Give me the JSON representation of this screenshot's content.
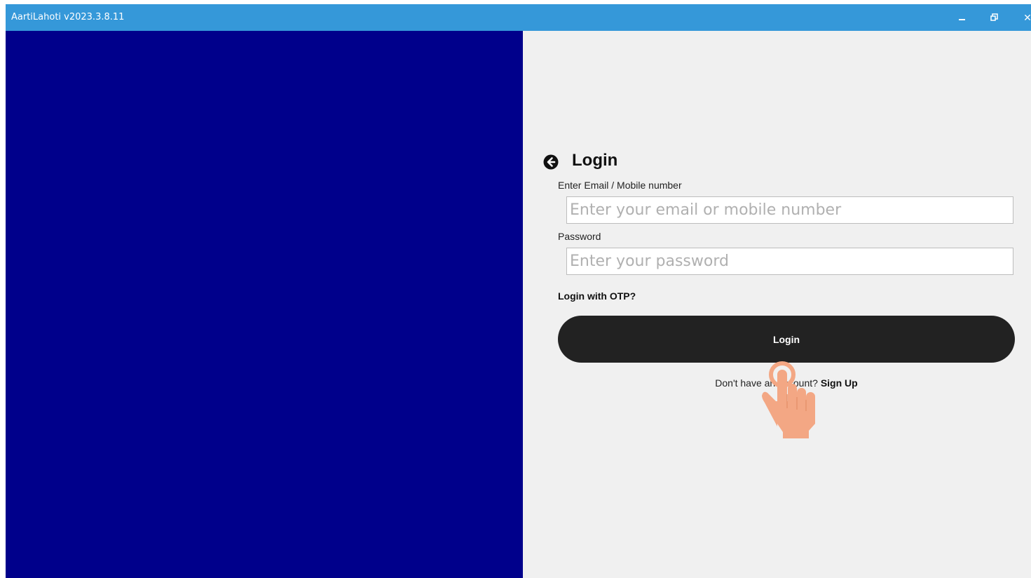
{
  "window": {
    "title": "AartiLahoti v2023.3.8.11",
    "minimize_glyph": "minimize-icon",
    "maximize_glyph": "restore-icon",
    "close_label": "✕"
  },
  "colors": {
    "titlebar": "#3598d9",
    "left_panel": "#00008b",
    "right_panel": "#f0f0f0",
    "button": "#222222"
  },
  "login": {
    "heading": "Login",
    "back_icon": "arrow-left-circle-icon",
    "email_label": "Enter Email / Mobile number",
    "email_placeholder": "Enter your email or mobile number",
    "email_value": "",
    "password_label": "Password",
    "password_placeholder": "Enter your password",
    "password_value": "",
    "otp_link": "Login with OTP?",
    "login_button": "Login",
    "signup_prompt": "Don't have an account?",
    "signup_link": "Sign Up"
  },
  "overlay": {
    "pointer_icon": "hand-pointer-icon"
  }
}
